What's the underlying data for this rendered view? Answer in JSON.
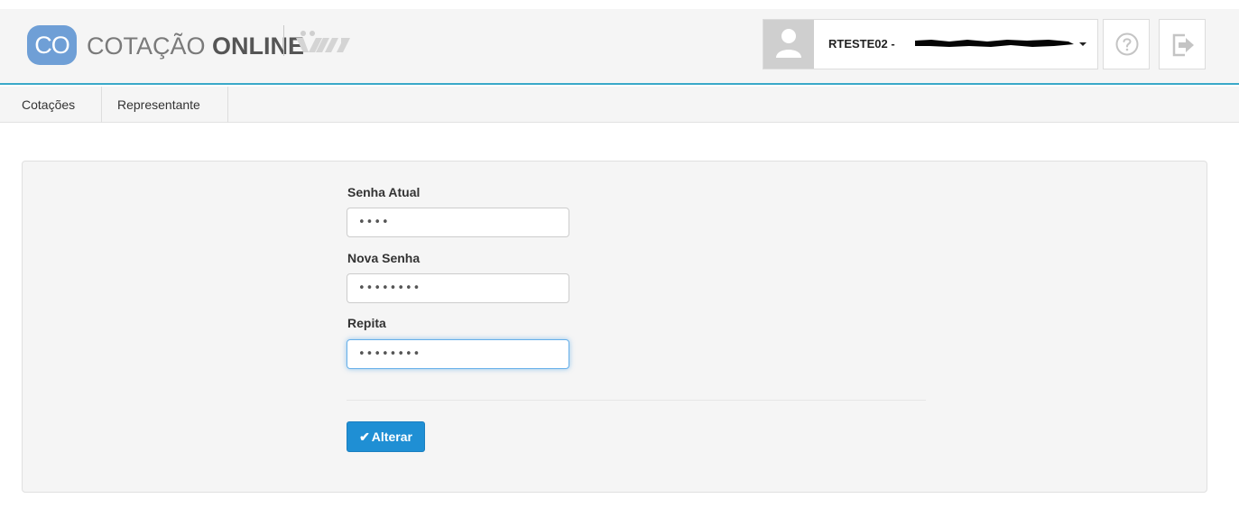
{
  "header": {
    "logo_badge": "CO",
    "title_light": "COTAÇÃO ",
    "title_bold": "ONLINE",
    "user_label": "RTESTE02 - ",
    "icons": {
      "avatar": "user-silhouette-icon",
      "help": "help-circle-icon",
      "logout": "logout-arrow-icon"
    }
  },
  "nav": {
    "items": [
      {
        "label": "Cotações"
      },
      {
        "label": "Representante"
      }
    ]
  },
  "form": {
    "current_password": {
      "label": "Senha Atual",
      "value": "••••"
    },
    "new_password": {
      "label": "Nova Senha",
      "value": "••••••••"
    },
    "repeat_password": {
      "label": "Repita",
      "value": "••••••••"
    },
    "submit_label": "Alterar"
  },
  "colors": {
    "accent": "#3aa9c9",
    "logo": "#6f9fd6",
    "button": "#1f8fd4",
    "focus": "#66afe9"
  }
}
